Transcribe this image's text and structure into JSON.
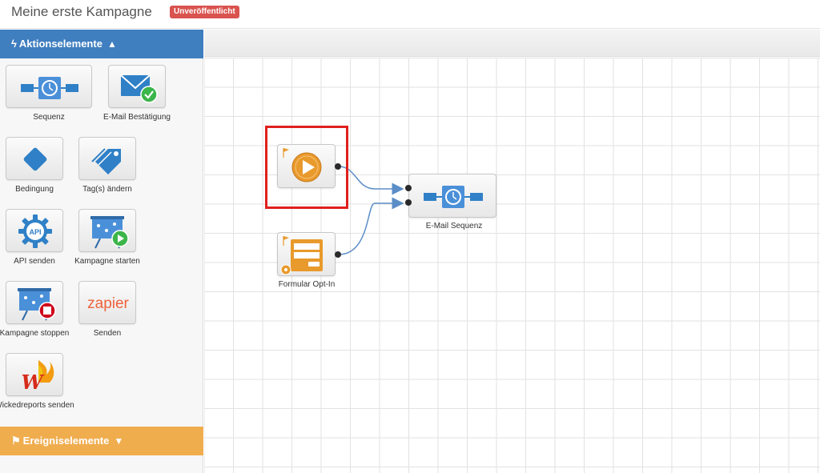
{
  "header": {
    "title": "Meine erste Kampagne",
    "status_badge": "Unveröffentlicht"
  },
  "sidebar": {
    "action_panel": {
      "title": "Aktionselemente",
      "icon": "bolt-icon",
      "state_icon": "chevron-up-icon"
    },
    "tiles": [
      {
        "label": "Sequenz",
        "icon": "sequence-clock-icon"
      },
      {
        "label": "E-Mail Bestätigung",
        "icon": "email-check-icon"
      },
      {
        "label": "Bedingung",
        "icon": "diamond-condition-icon"
      },
      {
        "label": "Tag(s) ändern",
        "icon": "tags-icon"
      },
      {
        "label": "API senden",
        "icon": "api-gear-icon"
      },
      {
        "label": "Kampagne starten",
        "icon": "presentation-play-icon"
      },
      {
        "label": "Kampagne stoppen",
        "icon": "presentation-stop-icon"
      },
      {
        "label": "Senden",
        "icon": "zapier-logo",
        "logo_text": "zapier"
      },
      {
        "label": "Wickedreports senden",
        "icon": "wickedreports-logo"
      }
    ],
    "event_panel": {
      "title": "Ereigniselemente",
      "icon": "flag-icon",
      "state_icon": "chevron-down-icon"
    }
  },
  "canvas": {
    "nodes": [
      {
        "id": "start",
        "label": "",
        "icon": "play-icon",
        "flag": "flag-icon",
        "highlighted": true
      },
      {
        "id": "optin",
        "label": "Formular Opt-In",
        "icon": "form-icon",
        "flag": "flag-icon"
      },
      {
        "id": "sequence",
        "label": "E-Mail Sequenz",
        "icon": "sequence-clock-icon"
      }
    ]
  },
  "colors": {
    "accent_blue": "#3f7ebf",
    "accent_orange": "#f0ad4e",
    "badge_red": "#d9534f",
    "highlight_red": "#e0201c"
  }
}
